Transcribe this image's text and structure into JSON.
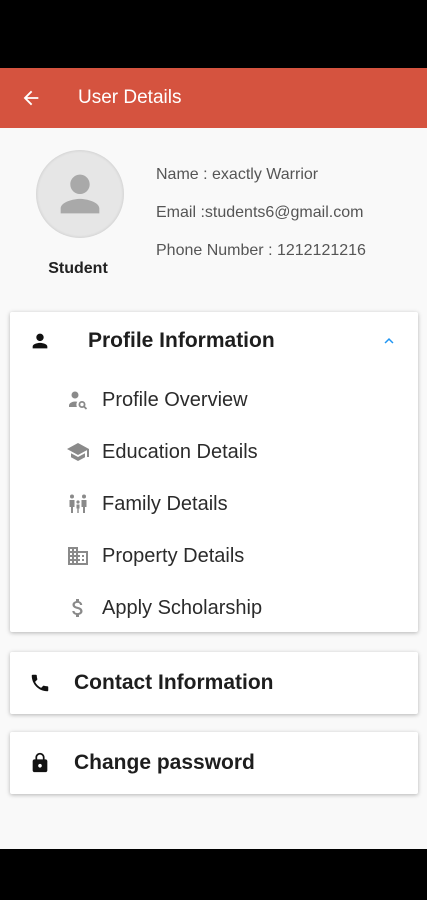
{
  "app_bar": {
    "title": "User Details"
  },
  "user": {
    "role": "Student",
    "name_line": "Name : exactly   Warrior",
    "email_line": "Email :students6@gmail.com",
    "phone_line": "Phone Number : 1212121216"
  },
  "sections": {
    "profile": {
      "title": "Profile Information",
      "items": [
        {
          "label": "Profile Overview",
          "icon": "person-search-icon"
        },
        {
          "label": "Education Details",
          "icon": "school-icon"
        },
        {
          "label": "Family Details",
          "icon": "family-icon"
        },
        {
          "label": "Property Details",
          "icon": "building-icon"
        },
        {
          "label": "Apply Scholarship",
          "icon": "dollar-icon"
        }
      ]
    },
    "contact": {
      "title": "Contact Information"
    },
    "password": {
      "title": "Change password"
    }
  },
  "colors": {
    "app_bar": "#d5533f",
    "accent": "#2196f3",
    "icon_grey": "#8a8a8a"
  }
}
